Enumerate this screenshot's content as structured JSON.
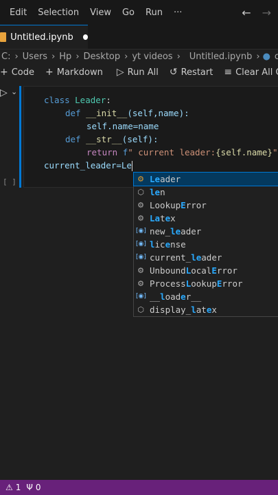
{
  "menubar": {
    "items": [
      "Edit",
      "Selection",
      "View",
      "Go",
      "Run",
      "···"
    ],
    "back_icon": "arrow-left-icon",
    "forward_icon": "arrow-right-icon"
  },
  "tab": {
    "label": "Untitled.ipynb"
  },
  "breadcrumb": {
    "segments": [
      "C:",
      "Users",
      "Hp",
      "Desktop",
      "yt videos"
    ],
    "file": "Untitled.ipynb",
    "symbol": "class"
  },
  "toolbar": {
    "code": "Code",
    "markdown": "Markdown",
    "run_all": "Run All",
    "restart": "Restart",
    "clear_all": "Clear All Ou"
  },
  "cell": {
    "exec_count": "[ ]",
    "lines": {
      "l1_kw": "class ",
      "l1_name": "Leader",
      "l1_colon": ":",
      "l2_kw": "def ",
      "l2_fn": "__init__",
      "l2_rest": "(self,name):",
      "l3": "self.name=name",
      "l4_kw": "def ",
      "l4_fn": "__str__",
      "l4_rest": "(self):",
      "l5_kw": "return ",
      "l5_f": "f",
      "l5_str": "\" current leader:",
      "l5_interp": "{self.name}",
      "l5_end": "\"",
      "l6": "current_leader=Le"
    }
  },
  "suggest": {
    "items": [
      {
        "pre": "",
        "match": "Le",
        "post": "ader",
        "icon": "class-icon"
      },
      {
        "pre": "",
        "match": "le",
        "post": "n",
        "icon": "cube-icon"
      },
      {
        "pre": "Lookup",
        "match": "E",
        "post": "rror",
        "icon": "class-icon"
      },
      {
        "pre": "",
        "match": "La",
        "post": "t",
        "post2": "e",
        "post3": "x",
        "icon": "class-icon"
      },
      {
        "pre": "new_",
        "match": "le",
        "post": "ader",
        "icon": "variable-icon"
      },
      {
        "pre": "",
        "match": "l",
        "post": "ic",
        "post2": "e",
        "post3": "nse",
        "icon": "variable-icon"
      },
      {
        "pre": "current_",
        "match": "le",
        "post": "ader",
        "icon": "variable-icon"
      },
      {
        "pre": "Unbound",
        "match": "L",
        "post": "ocal",
        "post2": "E",
        "post3": "rror",
        "icon": "class-icon"
      },
      {
        "pre": "Process",
        "match": "L",
        "post": "ookup",
        "post2": "E",
        "post3": "rror",
        "icon": "class-icon"
      },
      {
        "pre": "__",
        "match": "l",
        "post": "oad",
        "post2": "e",
        "post3": "r__",
        "icon": "variable-icon"
      },
      {
        "pre": "display_",
        "match": "l",
        "post": "at",
        "post2": "e",
        "post3": "x",
        "icon": "cube-icon"
      }
    ]
  },
  "statusbar": {
    "warnings": "1",
    "ports": "0"
  }
}
